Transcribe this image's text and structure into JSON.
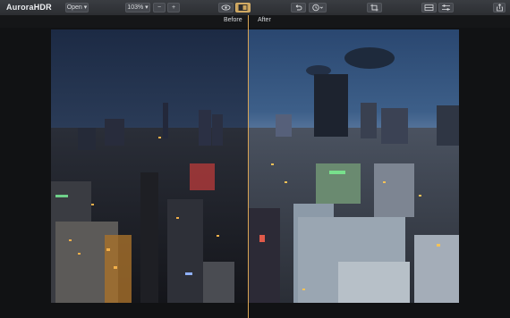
{
  "app": {
    "logo_prefix": "Aurora",
    "logo_suffix": "HDR"
  },
  "toolbar": {
    "open_label": "Open ▾",
    "zoom_label": "103% ▾",
    "zoom_out_label": "−",
    "zoom_in_label": "+"
  },
  "compare": {
    "before_label": "Before",
    "after_label": "After"
  },
  "colors": {
    "divider": "#d9a454",
    "active_button": "#caa35c"
  }
}
